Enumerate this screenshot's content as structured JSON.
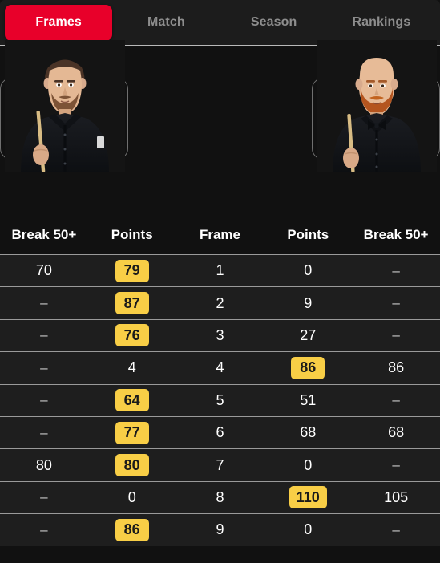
{
  "tabs": [
    {
      "label": "Frames",
      "active": true
    },
    {
      "label": "Match",
      "active": false
    },
    {
      "label": "Season",
      "active": false
    },
    {
      "label": "Rankings",
      "active": false
    }
  ],
  "players": {
    "left": {
      "icon": "player-photo-left",
      "description": "Snooker player with short dark hair and beard holding a cue, wearing a black shirt"
    },
    "right": {
      "icon": "player-photo-right",
      "description": "Bald snooker player with a ginger beard and bow tie holding a cue, wearing a black shirt"
    }
  },
  "colors": {
    "accent_red": "#E8002A",
    "badge_yellow": "#F8CE46",
    "page_background": "#111111",
    "row_background": "#1E1E1E",
    "row_divider": "#9A9A9A",
    "inactive_tab_text": "#8D8D8D"
  },
  "table": {
    "headers": [
      "Break 50+",
      "Points",
      "Frame",
      "Points",
      "Break 50+"
    ],
    "rows": [
      {
        "left_break": "70",
        "left_points": "79",
        "left_win": true,
        "frame": "1",
        "right_points": "0",
        "right_win": false,
        "right_break": "–"
      },
      {
        "left_break": "–",
        "left_points": "87",
        "left_win": true,
        "frame": "2",
        "right_points": "9",
        "right_win": false,
        "right_break": "–"
      },
      {
        "left_break": "–",
        "left_points": "76",
        "left_win": true,
        "frame": "3",
        "right_points": "27",
        "right_win": false,
        "right_break": "–"
      },
      {
        "left_break": "–",
        "left_points": "4",
        "left_win": false,
        "frame": "4",
        "right_points": "86",
        "right_win": true,
        "right_break": "86"
      },
      {
        "left_break": "–",
        "left_points": "64",
        "left_win": true,
        "frame": "5",
        "right_points": "51",
        "right_win": false,
        "right_break": "–"
      },
      {
        "left_break": "–",
        "left_points": "77",
        "left_win": true,
        "frame": "6",
        "right_points": "68",
        "right_win": false,
        "right_break": "68"
      },
      {
        "left_break": "80",
        "left_points": "80",
        "left_win": true,
        "frame": "7",
        "right_points": "0",
        "right_win": false,
        "right_break": "–"
      },
      {
        "left_break": "–",
        "left_points": "0",
        "left_win": false,
        "frame": "8",
        "right_points": "110",
        "right_win": true,
        "right_break": "105"
      },
      {
        "left_break": "–",
        "left_points": "86",
        "left_win": true,
        "frame": "9",
        "right_points": "0",
        "right_win": false,
        "right_break": "–"
      }
    ]
  }
}
